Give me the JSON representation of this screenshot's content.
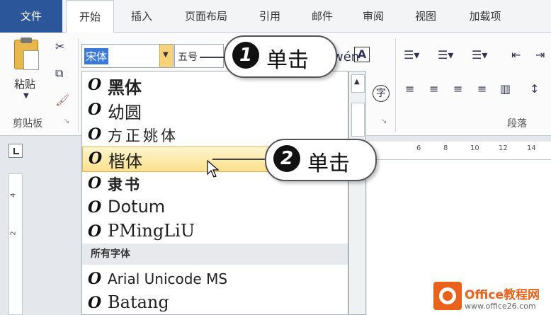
{
  "tabs": [
    {
      "label": "文件"
    },
    {
      "label": "开始"
    },
    {
      "label": "插入"
    },
    {
      "label": "页面布局"
    },
    {
      "label": "引用"
    },
    {
      "label": "邮件"
    },
    {
      "label": "审阅"
    },
    {
      "label": "视图"
    },
    {
      "label": "加载项"
    }
  ],
  "clipboard": {
    "paste_label": "粘贴",
    "group_label": "剪贴板"
  },
  "font": {
    "current_font": "宋体",
    "current_size": "五号"
  },
  "paragraph": {
    "group_label": "段落"
  },
  "font_list": {
    "recent": [
      "黑体",
      "幼圆",
      "方正姚体",
      "楷体",
      "隶书",
      "Dotum",
      "PMingLiU"
    ],
    "section_header": "所有字体",
    "all": [
      "Arial Unicode MS",
      "Batang"
    ],
    "selected": "楷体"
  },
  "ruler": {
    "ticks": [
      "6",
      "8",
      "10",
      "12",
      "14"
    ],
    "vticks": [
      "4",
      "2"
    ]
  },
  "callouts": [
    {
      "number": "1",
      "text": "单击"
    },
    {
      "number": "2",
      "text": "单击"
    }
  ],
  "watermark": {
    "text": "Office教程网",
    "url": "www.office26.com"
  },
  "colors": {
    "file_tab": "#2b579a",
    "selected_item": "#fbe08c",
    "accent": "#e8621c"
  }
}
